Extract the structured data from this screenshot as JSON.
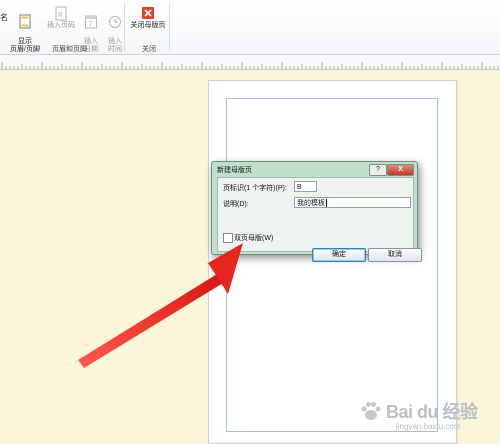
{
  "ribbon": {
    "edge_glyph": "名",
    "buttons": {
      "show_header_footer": "显示\n页眉/页脚",
      "insert_page_number": "插入页码",
      "insert_date": "插入\n日期",
      "insert_time": "插入\n时间",
      "close_master": "关闭母版页"
    },
    "groups": {
      "header_footer": "页眉和页脚",
      "close": "关闭"
    },
    "colors": {
      "close_icon": "#d9462f"
    }
  },
  "dialog": {
    "title": "新建母版页",
    "help_label": "?",
    "close_label": "X",
    "page_id_label": "页标识(1 个字符)(P):",
    "page_id_value": "B",
    "description_label": "说明(D):",
    "description_value": "我的模板",
    "two_page_label": "双页母版(W)",
    "two_page_checked": false,
    "ok_label": "确定",
    "cancel_label": "取消"
  },
  "watermark": {
    "brand": "Bai du 经验",
    "url": "jingyan.baidu.com"
  },
  "annotation": {
    "arrow_color": "#e8251f"
  }
}
